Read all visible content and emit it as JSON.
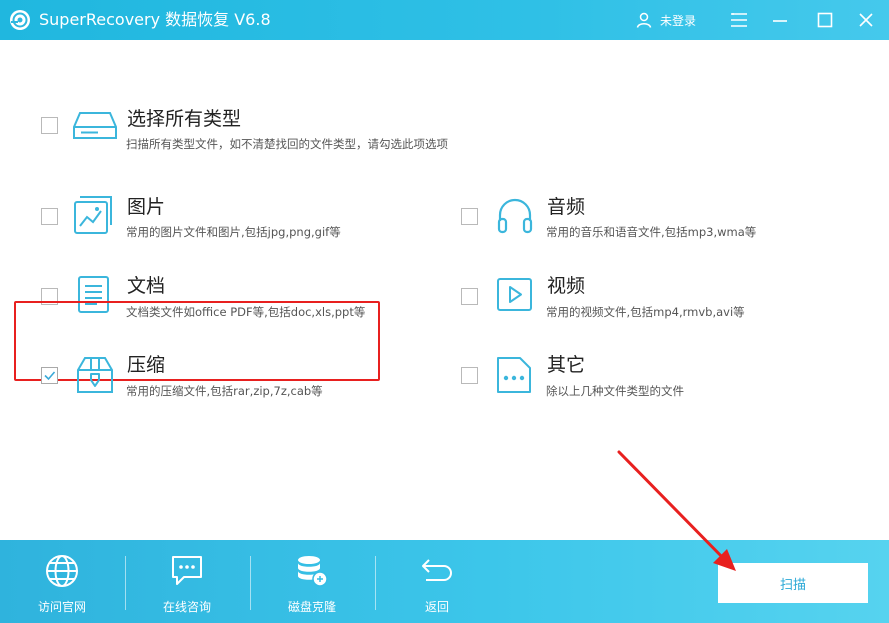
{
  "window": {
    "title": "SuperRecovery 数据恢复 V6.8",
    "user_label": "未登录"
  },
  "options": {
    "all": {
      "title": "选择所有类型",
      "desc": "扫描所有类型文件，如不清楚找回的文件类型，请勾选此项选项",
      "checked": false
    },
    "image": {
      "title": "图片",
      "desc": "常用的图片文件和图片,包括jpg,png,gif等",
      "checked": false
    },
    "audio": {
      "title": "音频",
      "desc": "常用的音乐和语音文件,包括mp3,wma等",
      "checked": false
    },
    "document": {
      "title": "文档",
      "desc": "文档类文件如office PDF等,包括doc,xls,ppt等",
      "checked": false
    },
    "video": {
      "title": "视频",
      "desc": "常用的视频文件,包括mp4,rmvb,avi等",
      "checked": false
    },
    "archive": {
      "title": "压缩",
      "desc": "常用的压缩文件,包括rar,zip,7z,cab等",
      "checked": true
    },
    "other": {
      "title": "其它",
      "desc": "除以上几种文件类型的文件",
      "checked": false
    }
  },
  "bottom_nav": [
    {
      "label": "访问官网",
      "icon": "globe-icon"
    },
    {
      "label": "在线咨询",
      "icon": "chat-icon"
    },
    {
      "label": "磁盘克隆",
      "icon": "database-icon"
    },
    {
      "label": "返回",
      "icon": "back-arrow-icon"
    }
  ],
  "scan_button": "扫描",
  "colors": {
    "brand": "#2fc0e6",
    "icon_stroke": "#3bb6dc",
    "highlight_border": "#e8201f",
    "scan_text": "#2aa8d6"
  }
}
